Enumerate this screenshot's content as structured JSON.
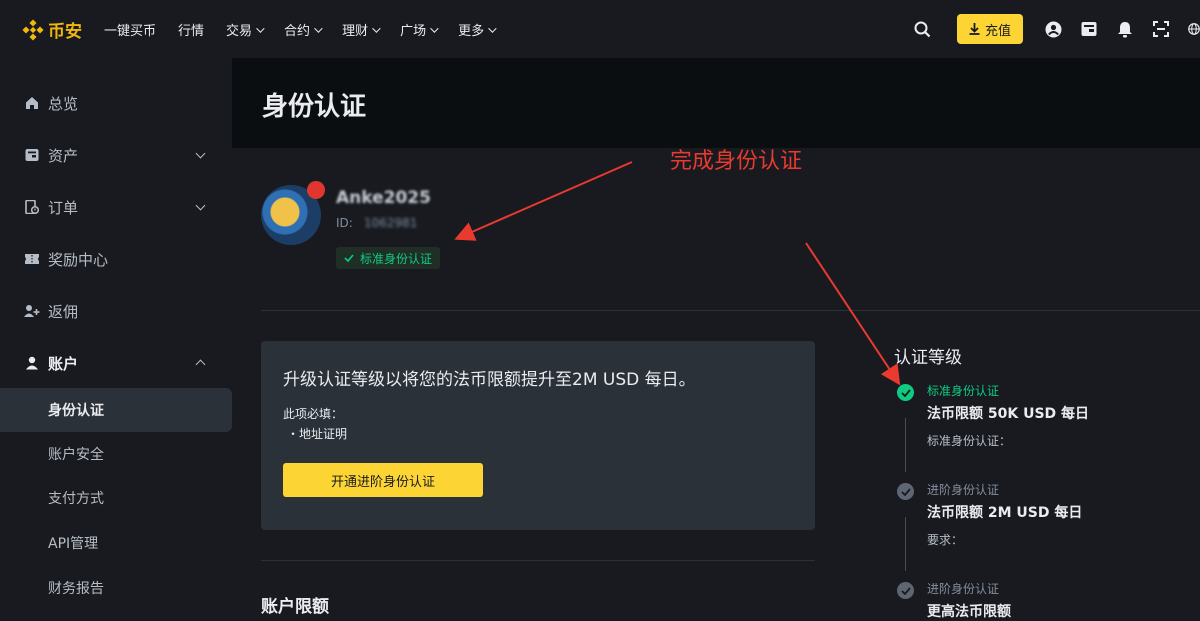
{
  "topnav": {
    "logo_text": "币安",
    "items": [
      {
        "label": "一键买币",
        "dropdown": false
      },
      {
        "label": "行情",
        "dropdown": false
      },
      {
        "label": "交易",
        "dropdown": true
      },
      {
        "label": "合约",
        "dropdown": true
      },
      {
        "label": "理财",
        "dropdown": true
      },
      {
        "label": "广场",
        "dropdown": true
      },
      {
        "label": "更多",
        "dropdown": true
      }
    ],
    "deposit_label": "充值",
    "right_icons": [
      "search-icon",
      "download-icon",
      "user-icon",
      "wallet-icon",
      "bell-icon",
      "qr-scan-icon"
    ]
  },
  "sidebar": {
    "items": [
      {
        "label": "总览",
        "icon": "home-icon"
      },
      {
        "label": "资产",
        "icon": "wallet-icon"
      },
      {
        "label": "订单",
        "icon": "orders-icon"
      },
      {
        "label": "奖励中心",
        "icon": "ticket-icon"
      },
      {
        "label": "返佣",
        "icon": "referral-icon"
      },
      {
        "label": "账户",
        "icon": "user-icon"
      }
    ],
    "subitems": [
      {
        "label": "身份认证",
        "active": true
      },
      {
        "label": "账户安全",
        "active": false
      },
      {
        "label": "支付方式",
        "active": false
      },
      {
        "label": "API管理",
        "active": false
      },
      {
        "label": "财务报告",
        "active": false
      }
    ]
  },
  "main": {
    "page_title": "身份认证",
    "profile": {
      "username": "Anke2025",
      "id_label": "ID:",
      "id_value": "1062981",
      "badge": "标准身份认证"
    },
    "upgrade_card": {
      "title": "升级认证等级以将您的法币限额提升至2M USD 每日。",
      "required_label": "此项必填：",
      "required_item": "地址证明",
      "button_label": "开通进阶身份认证"
    },
    "limits_title": "账户限额",
    "levels": {
      "title": "认证等级",
      "items": [
        {
          "name": "标准身份认证",
          "limit": "法币限额 50K USD 每日",
          "sub": "标准身份认证：",
          "done": true
        },
        {
          "name": "进阶身份认证",
          "limit": "法币限额 2M USD 每日",
          "sub": "要求：",
          "done": false
        },
        {
          "name": "进阶身份认证",
          "limit": "更高法币限额",
          "sub": "",
          "done": false
        }
      ]
    }
  },
  "annotation": {
    "text": "完成身份认证",
    "color": "#e83a2e"
  },
  "colors": {
    "accent": "#fcd535",
    "success": "#0ecb81",
    "background": "#181a20"
  }
}
